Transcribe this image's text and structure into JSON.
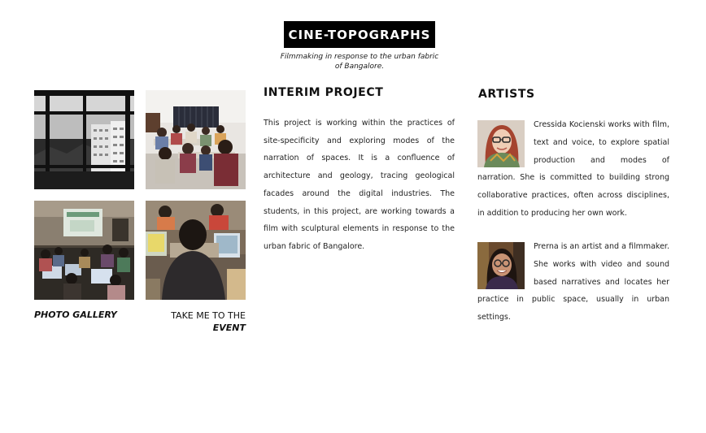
{
  "header": {
    "title": "CINE-TOPOGRAPHS",
    "subtitle": "Filmmaking in response to the urban fabric of Bangalore."
  },
  "gallery": {
    "photo_gallery_label": "PHOTO GALLERY",
    "event_link_prefix": "TAKE ME TO THE",
    "event_link_emphasis": "EVENT"
  },
  "interim": {
    "title": "INTERIM PROJECT",
    "body": "This project is working within the practices of site-specificity and exploring modes of the narration of spaces. It is a confluence of architecture and geology, tracing geological facades around the digital industries. The students, in this project, are working towards a film with sculptural elements in response to the urban fabric of Bangalore."
  },
  "artists": {
    "title": "ARTISTS",
    "items": [
      {
        "bio": "Cressida Kocienski works with film, text and voice, to explore spatial production and modes of narration. She is committed to building strong collaborative practices, often across disciplines, in addition to producing her own work."
      },
      {
        "bio": "Prerna is an artist and a filmmaker. She works with video and sound based narratives and locates her practice in public space, usually in urban settings."
      }
    ]
  }
}
